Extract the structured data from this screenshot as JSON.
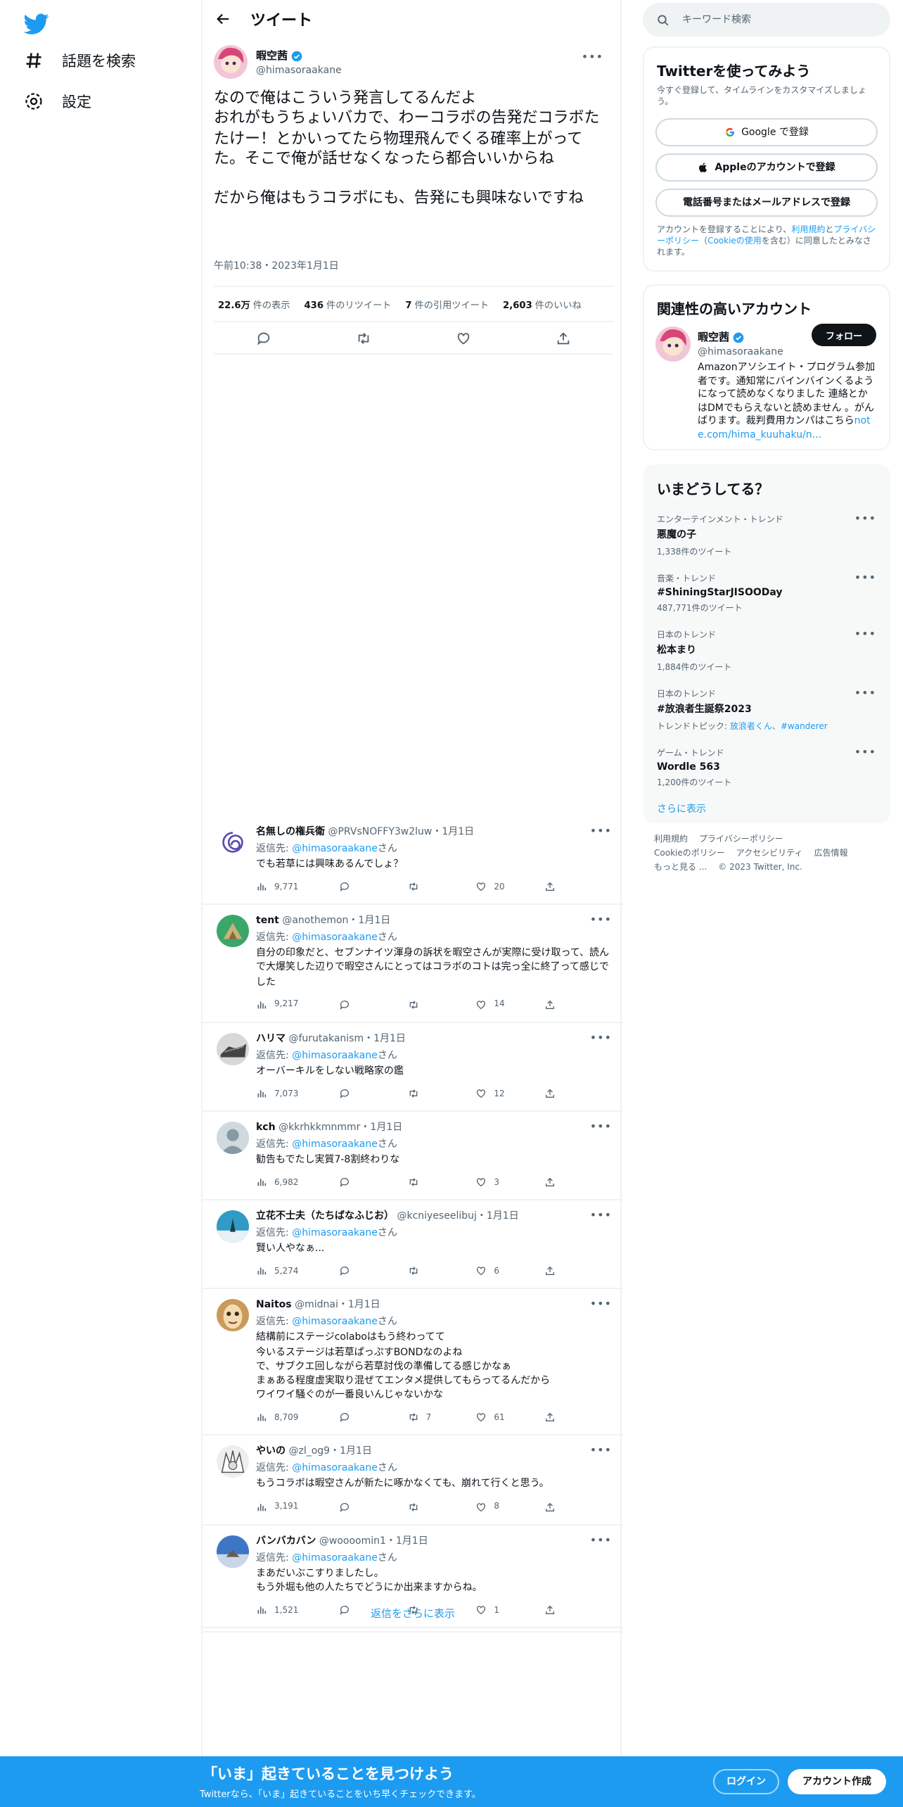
{
  "nav": {
    "explore": "話題を検索",
    "settings": "設定"
  },
  "header": {
    "title": "ツイート"
  },
  "tweet": {
    "name": "暇空茜",
    "handle": "@himasoraakane",
    "text": "なので俺はこういう発言してるんだよ\nおれがもうちょいバカで、わーコラボの告発だコラボたたけー！とかいってたら物理飛んでくる確率上がってた。そこで俺が話せなくなったら都合いいからね\n\nだから俺はもうコラボにも、告発にも興味ないですね",
    "time": "午前10:38・2023年1月1日",
    "views_num": "22.6万",
    "views_label": "件の表示",
    "retweets_num": "436",
    "retweets_label": "件のリツイート",
    "quotes_num": "7",
    "quotes_label": "件の引用ツイート",
    "likes_num": "2,603",
    "likes_label": "件のいいね"
  },
  "reply_prefix": "返信先: ",
  "reply_suffix": "さん",
  "replies": [
    {
      "name": "名無しの権兵衛",
      "meta": "@PRVsNOFFY3w2luw・1月1日",
      "to": "@himasoraakane",
      "text": "でも若草には興味あるんでしょ？",
      "views": "9,771",
      "replies": "",
      "retweets": "",
      "likes": "20"
    },
    {
      "name": "tent",
      "meta": "@anothemon・1月1日",
      "to": "@himasoraakane",
      "text": "自分の印象だと、セブンナイツ渾身の訴状を暇空さんが実際に受け取って、読んで大爆笑した辺りで暇空さんにとってはコラボのコトは完っ全に終了って感じでした",
      "views": "9,217",
      "replies": "",
      "retweets": "",
      "likes": "14"
    },
    {
      "name": "ハリマ",
      "meta": "@furutakanism・1月1日",
      "to": "@himasoraakane",
      "text": "オーバーキルをしない戦略家の鑑",
      "views": "7,073",
      "replies": "",
      "retweets": "",
      "likes": "12"
    },
    {
      "name": "kch",
      "meta": "@kkrhkkmnmmr・1月1日",
      "to": "@himasoraakane",
      "text": "勧告もでたし実質7-8割終わりな",
      "views": "6,982",
      "replies": "",
      "retweets": "",
      "likes": "3"
    },
    {
      "name": "立花不士夫（たちばなふじお）",
      "meta": "@kcniyeseelibuj・1月1日",
      "to": "@himasoraakane",
      "text": "賢い人やなぁ...",
      "views": "5,274",
      "replies": "",
      "retweets": "",
      "likes": "6"
    },
    {
      "name": "Naitos",
      "meta": "@midnai・1月1日",
      "to": "@himasoraakane",
      "text": "結構前にステージcolaboはもう終わってて\n今いるステージは若草ぱっぷすBONDなのよね\nで、サブクエ回しながら若草討伐の準備してる感じかなぁ\nまぁある程度虚実取り混ぜてエンタメ提供してもらってるんだから\nワイワイ騒ぐのが一番良いんじゃないかな",
      "views": "8,709",
      "replies": "",
      "retweets": "7",
      "likes": "61"
    },
    {
      "name": "やいの",
      "meta": "@zl_og9・1月1日",
      "to": "@himasoraakane",
      "text": "もうコラボは暇空さんが新たに啄かなくても、崩れて行くと思う。",
      "views": "3,191",
      "replies": "",
      "retweets": "",
      "likes": "8"
    },
    {
      "name": "バンバカバン",
      "meta": "@woooomin1・1月1日",
      "to": "@himasoraakane",
      "text": "まあだいぶこすりましたし。\nもう外堀も他の人たちでどうにか出来ますからね。",
      "views": "1,521",
      "replies": "",
      "retweets": "",
      "likes": "1"
    }
  ],
  "show_more_replies": "返信をさらに表示",
  "search": {
    "placeholder": "キーワード検索"
  },
  "signup": {
    "title": "Twitterを使ってみよう",
    "subtitle": "今すぐ登録して、タイムラインをカスタマイズしましょう。",
    "google": "Google で登録",
    "apple": "Appleのアカウントで登録",
    "phone": "電話番号またはメールアドレスで登録",
    "legal_1": "アカウントを登録することにより、",
    "terms": "利用規約",
    "legal_2": "と",
    "privacy": "プライバシーポリシー",
    "legal_3": "（",
    "cookie": "Cookieの使用",
    "legal_4": "を含む）に同意したとみなされます。"
  },
  "related": {
    "title": "関連性の高いアカウント",
    "name": "暇空茜",
    "handle": "@himasoraakane",
    "follow": "フォロー",
    "bio": "Amazonアソシエイト・プログラム参加者です。通知常にバインバインくるようになって読めなくなりました 連絡とかはDMでもらえないと読めません 。がんばります。裁判費用カンパはこちら",
    "bio_link": "note.com/hima_kuuhaku/n..."
  },
  "trends": {
    "title": "いまどうしてる？",
    "items": [
      {
        "category": "エンターテインメント・トレンド",
        "name": "悪魔の子",
        "count": "1,338件のツイート"
      },
      {
        "category": "音楽・トレンド",
        "name": "#ShiningStarJISOODay",
        "count": "487,771件のツイート"
      },
      {
        "category": "日本のトレンド",
        "name": "松本まり",
        "count": "1,884件のツイート"
      },
      {
        "category": "日本のトレンド",
        "name": "#放浪者生誕祭2023",
        "count": "トレンドトピック: ",
        "links": "放浪者くん、#wanderer"
      },
      {
        "category": "ゲーム・トレンド",
        "name": "Wordle 563",
        "count": "1,200件のツイート"
      }
    ],
    "show_more": "さらに表示"
  },
  "footer": {
    "terms": "利用規約",
    "privacy": "プライバシーポリシー",
    "cookie": "Cookieのポリシー",
    "access": "アクセシビリティ",
    "ads": "広告情報",
    "more": "もっと見る ...",
    "copyright": "© 2023 Twitter, Inc."
  },
  "bottom": {
    "title": "「いま」起きていることを見つけよう",
    "subtitle": "Twitterなら、「いま」起きていることをいち早くチェックできます。",
    "login": "ログイン",
    "signup": "アカウント作成"
  },
  "colors": {
    "accent": "#1d9bf0",
    "text": "#0f1419",
    "secondary": "#536471"
  }
}
